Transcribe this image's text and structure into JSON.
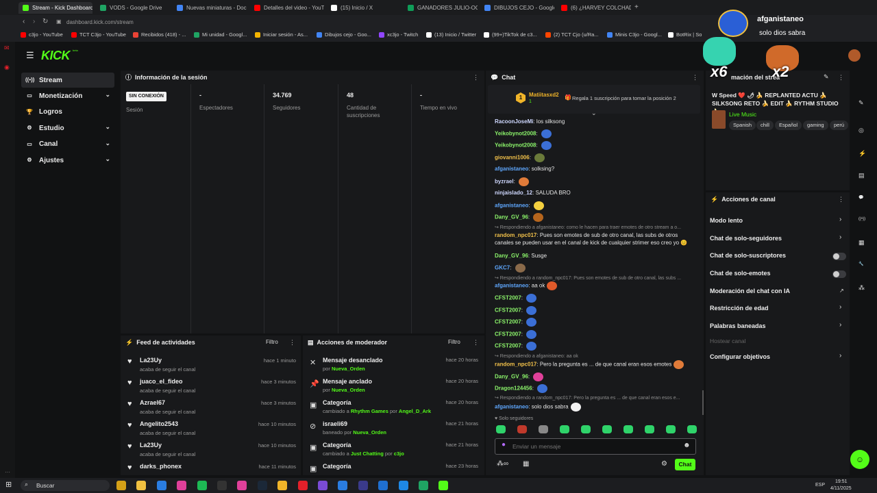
{
  "browser": {
    "tabs": [
      {
        "label": "Stream - Kick Dashboard",
        "color": "#53fc18"
      },
      {
        "label": "VODS - Google Drive",
        "color": "#1fa463"
      },
      {
        "label": "Nuevas miniaturas - Doc",
        "color": "#4285f4"
      },
      {
        "label": "Detalles del video - YouT",
        "color": "#ff0000"
      },
      {
        "label": "(15) Inicio / X",
        "color": "#ffffff"
      },
      {
        "label": "GANADORES JULIO-OCT",
        "color": "#0f9d58"
      },
      {
        "label": "DIBUJOS CEJO - Google",
        "color": "#4285f4"
      },
      {
        "label": "(6) ¿HARVEY COLCHADO",
        "color": "#ff0000"
      }
    ],
    "url": "dashboard.kick.com/stream",
    "bookmarks": [
      {
        "label": "c3jo - YouTube",
        "color": "#ff0000"
      },
      {
        "label": "TCT C3jo - YouTube",
        "color": "#ff0000"
      },
      {
        "label": "Recibidos (418) - ...",
        "color": "#ea4335"
      },
      {
        "label": "Mi unidad - Googl...",
        "color": "#1fa463"
      },
      {
        "label": "Iniciar sesión - As...",
        "color": "#f4b400"
      },
      {
        "label": "Dibujos cejo - Goo...",
        "color": "#4285f4"
      },
      {
        "label": "xc3jo - Twitch",
        "color": "#9146ff"
      },
      {
        "label": "(13) Inicio / Twitter",
        "color": "#ffffff"
      },
      {
        "label": "(99+)TikTok de c3...",
        "color": "#ffffff"
      },
      {
        "label": "(2) TCT Cjo (u/Ra...",
        "color": "#ff4500"
      },
      {
        "label": "Minis C3jo - Googl...",
        "color": "#4285f4"
      },
      {
        "label": "BotRix | So",
        "color": "#ffffff"
      }
    ]
  },
  "kick": {
    "logo": "KICK",
    "logo_sup": "beta",
    "sidebar": [
      {
        "label": "Stream",
        "icon": "stream-icon",
        "glyph": "((•))"
      },
      {
        "label": "Monetización",
        "icon": "money-icon",
        "glyph": "▭"
      },
      {
        "label": "Logros",
        "icon": "trophy-icon",
        "glyph": "🏆"
      },
      {
        "label": "Estudio",
        "icon": "studio-icon",
        "glyph": "⚙"
      },
      {
        "label": "Canal",
        "icon": "channel-icon",
        "glyph": "▭"
      },
      {
        "label": "Ajustes",
        "icon": "settings-icon",
        "glyph": "⚙"
      }
    ]
  },
  "session": {
    "title": "Información de la sesión",
    "status_badge": "SIN CONEXIÓN",
    "session_label": "Sesión",
    "stats": [
      {
        "value": "-",
        "label": "Espectadores"
      },
      {
        "value": "34.769",
        "label": "Seguidores"
      },
      {
        "value": "48",
        "label": "Cantidad de suscripciones"
      },
      {
        "value": "-",
        "label": "Tiempo en vivo"
      }
    ]
  },
  "feed": {
    "title": "Feed de actividades",
    "filter": "Filtro",
    "items": [
      {
        "name": "La23Uy",
        "action": "acaba de seguir el canal",
        "time": "hace 1 minuto"
      },
      {
        "name": "juaco_el_fideo",
        "action": "acaba de seguir el canal",
        "time": "hace 3 minutos"
      },
      {
        "name": "Azrael67",
        "action": "acaba de seguir el canal",
        "time": "hace 3 minutos"
      },
      {
        "name": "Angelito2543",
        "action": "acaba de seguir el canal",
        "time": "hace 10 minutos"
      },
      {
        "name": "La23Uy",
        "action": "acaba de seguir el canal",
        "time": "hace 10 minutos"
      },
      {
        "name": "darks_phonex",
        "action": "",
        "time": "hace 11 minutos"
      }
    ]
  },
  "moderator": {
    "title": "Acciones de moderador",
    "filter": "Filtro",
    "items": [
      {
        "title": "Mensaje desanclado",
        "pre": "por ",
        "hl1": "Nueva_Orden",
        "mid": "",
        "hl2": "",
        "time": "hace 20 horas",
        "glyph": "✕"
      },
      {
        "title": "Mensaje anclado",
        "pre": "por ",
        "hl1": "Nueva_Orden",
        "mid": "",
        "hl2": "",
        "time": "hace 20 horas",
        "glyph": "📌"
      },
      {
        "title": "Categoría",
        "pre": "cambiado a ",
        "hl1": "Rhythm Games",
        "mid": " por ",
        "hl2": "Angel_D_Ark",
        "time": "hace 20 horas",
        "glyph": "▣"
      },
      {
        "title": "israeli69",
        "pre": "baneado por ",
        "hl1": "Nueva_Orden",
        "mid": "",
        "hl2": "",
        "time": "hace 21 horas",
        "glyph": "⊘"
      },
      {
        "title": "Categoría",
        "pre": "cambiado a ",
        "hl1": "Just Chatting",
        "mid": " por ",
        "hl2": "c3jo",
        "time": "hace 21 horas",
        "glyph": "▣"
      },
      {
        "title": "Categoría",
        "pre": "",
        "hl1": "",
        "mid": "",
        "hl2": "",
        "time": "hace 23 horas",
        "glyph": "▣"
      }
    ]
  },
  "chat": {
    "title": "Chat",
    "pinned_user": "Matiitasxd2",
    "pinned_count": "1",
    "pinned_text": "Regala 1 suscripción para tomar la posición 2",
    "badge": "1",
    "messages": [
      {
        "user": "RacoonJoseMi",
        "color": "#cfd8ff",
        "text": "los silksong",
        "emote": ""
      },
      {
        "user": "Yeikobynot2008",
        "color": "#8cf56b",
        "text": "",
        "emote": "#3b6fd6"
      },
      {
        "user": "Yeikobynot2008",
        "color": "#8cf56b",
        "text": "",
        "emote": "#3b6fd6"
      },
      {
        "user": "giovanni1006",
        "color": "#f3c24a",
        "text": "",
        "emote": "#6a7a3a"
      },
      {
        "user": "afganistaneo",
        "color": "#5fa8ff",
        "text": "solksing?",
        "emote": ""
      },
      {
        "user": "byzrael",
        "color": "#cfd8ff",
        "text": "",
        "emote": "#e07b39"
      },
      {
        "user": "ninjaislado_12",
        "color": "#cfd8ff",
        "text": "SALUDA BRO",
        "emote": ""
      },
      {
        "user": "afganistaneo",
        "color": "#5fa8ff",
        "text": "",
        "emote": "#f4d03f"
      },
      {
        "user": "Dany_GV_96",
        "color": "#8cf56b",
        "text": "",
        "emote": "#b5651d"
      },
      {
        "reply": "↪ Respondiendo a afganistaneo: como le hacen para traer emotes de otro stream a o..."
      },
      {
        "user": "random_npc017",
        "color": "#f3c24a",
        "text": "Pues son emotes de sub de otro canal, las subs de otros",
        "emote": ""
      },
      {
        "cont": "canales se pueden usar en el canal de kick de cualquier strimer eso creo yo 😊"
      },
      {
        "user": "Dany_GV_96",
        "color": "#8cf56b",
        "text": "Susge",
        "emote": ""
      },
      {
        "user": "GKC7",
        "color": "#5fa8ff",
        "text": "",
        "emote": "#8a6a4a"
      },
      {
        "reply": "↪ Respondiendo a random_npc017: Pues son emotes de sub de otro canal, las subs ..."
      },
      {
        "user": "afganistaneo",
        "color": "#5fa8ff",
        "text": "aa ok",
        "emote": "#e05a2a"
      },
      {
        "user": "CFST2007",
        "color": "#8cf56b",
        "text": "",
        "emote": "#3b6fd6"
      },
      {
        "user": "CFST2007",
        "color": "#8cf56b",
        "text": "",
        "emote": "#3b6fd6"
      },
      {
        "user": "CFST2007",
        "color": "#8cf56b",
        "text": "",
        "emote": "#3b6fd6"
      },
      {
        "user": "CFST2007",
        "color": "#8cf56b",
        "text": "",
        "emote": "#3b6fd6"
      },
      {
        "user": "CFST2007",
        "color": "#8cf56b",
        "text": "",
        "emote": "#3b6fd6"
      },
      {
        "reply": "↪ Respondiendo a afganistaneo: aa ok"
      },
      {
        "user": "random_npc017",
        "color": "#f3c24a",
        "text": "Pero la pregunta es ... de que canal eran esos emotes",
        "emote": "#e07b39"
      },
      {
        "user": "Dany_GV_96",
        "color": "#8cf56b",
        "text": "",
        "emote": "#e0409a"
      },
      {
        "user": "Dragon124456",
        "color": "#8cf56b",
        "text": "",
        "emote": "#3b6fd6"
      },
      {
        "reply": "↪ Respondiendo a random_npc017: Pero la pregunta es ... de que canal eran esos e..."
      },
      {
        "user": "afganistaneo",
        "color": "#5fa8ff",
        "text": "solo dios sabra",
        "emote": "#f2f2f2"
      }
    ],
    "followers_only": "♥ Solo seguidores",
    "input_placeholder": "Enviar un mensaje",
    "send_label": "Chat"
  },
  "stream_info": {
    "title_partial": "mación del strea",
    "stream_title": "W Speed ❤️ 🌶 🍌 REPLANTED ACTU 🍌 SILKSONG RETO 🍌 EDIT 🍌 RYTHM STUDIO 🍌 ...",
    "category": "Live Music",
    "tags": [
      "Spanish",
      "chill",
      "Español",
      "gaming",
      "perú"
    ]
  },
  "channel_actions": {
    "title": "Acciones de canal",
    "items": [
      {
        "label": "Modo lento",
        "kind": "chevron"
      },
      {
        "label": "Chat de solo-seguidores",
        "kind": "chevron"
      },
      {
        "label": "Chat de solo-suscriptores",
        "kind": "toggle"
      },
      {
        "label": "Chat de solo-emotes",
        "kind": "toggle"
      },
      {
        "label": "Moderación del chat con IA",
        "kind": "external"
      },
      {
        "label": "Restricción de edad",
        "kind": "chevron"
      },
      {
        "label": "Palabras baneadas",
        "kind": "chevron"
      },
      {
        "label": "Hostear canal",
        "kind": "disabled"
      },
      {
        "label": "Configurar objetivos",
        "kind": "chevron"
      }
    ]
  },
  "overlay": {
    "user": "afganistaneo",
    "message": "solo dios sabra",
    "multiplier1": "x6",
    "multiplier2": "x2"
  },
  "taskbar": {
    "search": "Buscar",
    "lang": "ESP",
    "time": "19:51",
    "date": "4/11/2025"
  }
}
